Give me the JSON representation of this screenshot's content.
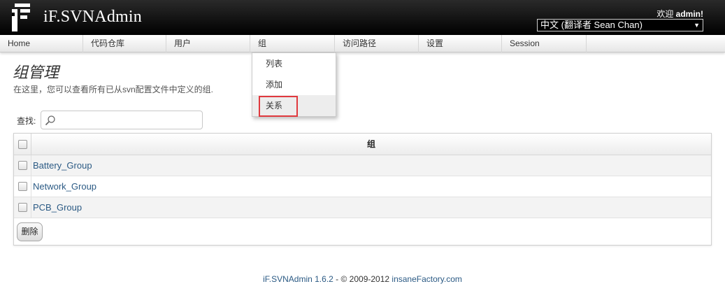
{
  "header": {
    "app_name": "iF.SVNAdmin",
    "welcome_prefix": "欢迎 ",
    "username": "admin!",
    "language_selected": "中文 (翻译者 Sean Chan)",
    "logo_icon": "svnadmin-logo-icon",
    "select_arrow": "▼"
  },
  "nav": {
    "items": [
      {
        "label": "Home"
      },
      {
        "label": "代码仓库"
      },
      {
        "label": "用户"
      },
      {
        "label": "组"
      },
      {
        "label": "访问路径"
      },
      {
        "label": "设置"
      },
      {
        "label": "Session"
      }
    ]
  },
  "dropdown": {
    "items": [
      {
        "label": "列表"
      },
      {
        "label": "添加"
      },
      {
        "label": "关系"
      }
    ],
    "highlight_color": "#e0393e"
  },
  "page": {
    "title": "组管理",
    "description": "在这里，您可以查看所有已从svn配置文件中定义的组."
  },
  "search": {
    "label": "查找:",
    "value": "",
    "icon": "search-icon"
  },
  "table": {
    "header": "组",
    "rows": [
      {
        "name": "Battery_Group"
      },
      {
        "name": "Network_Group"
      },
      {
        "name": "PCB_Group"
      }
    ],
    "delete_label": "删除"
  },
  "footer": {
    "app_version": "iF.SVNAdmin 1.6.2",
    "sep1": " - ",
    "copyright": "© 2009-2012 ",
    "company": "insaneFactory.com"
  },
  "colors": {
    "link": "#2b5a84",
    "header_bg": "#000000"
  }
}
